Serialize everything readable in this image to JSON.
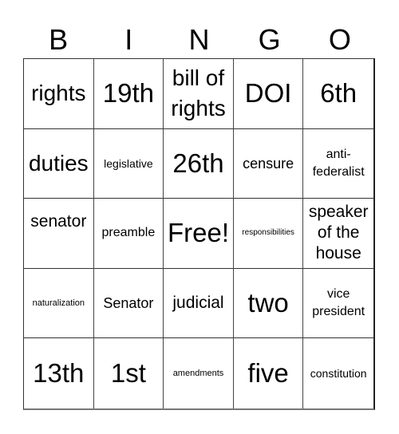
{
  "header": {
    "letters": [
      "B",
      "I",
      "N",
      "G",
      "O"
    ]
  },
  "grid": {
    "rows": [
      [
        "rights",
        "19th",
        "bill of rights",
        "DOI",
        "6th"
      ],
      [
        "duties",
        "legislative",
        "26th",
        "censure",
        "anti-federalist"
      ],
      [
        "senator",
        "preamble",
        "Free!",
        "responsibilities",
        "speaker of the house"
      ],
      [
        "naturalization",
        "Senator",
        "judicial",
        "two",
        "vice president"
      ],
      [
        "13th",
        "1st",
        "amendments",
        "five",
        "constitution"
      ]
    ]
  },
  "free_space": {
    "row": 2,
    "col": 2,
    "label": "Free!"
  },
  "colors": {
    "background": "#ffffff",
    "text": "#000000",
    "grid_line": "#333333"
  }
}
